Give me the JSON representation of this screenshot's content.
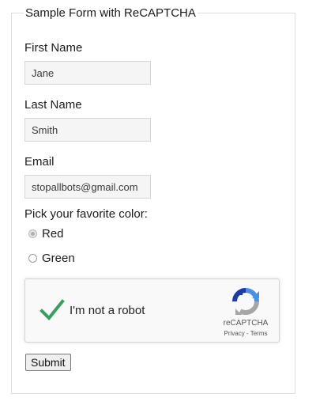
{
  "form": {
    "legend": "Sample Form with ReCAPTCHA",
    "first_name_label": "First Name",
    "first_name_value": "Jane",
    "last_name_label": "Last Name",
    "last_name_value": "Smith",
    "email_label": "Email",
    "email_value": "stopallbots@gmail.com",
    "color_prompt": "Pick your favorite color:",
    "color_options": [
      {
        "label": "Red",
        "checked": true
      },
      {
        "label": "Green",
        "checked": false
      }
    ],
    "submit_label": "Submit"
  },
  "recaptcha": {
    "label": "I'm not a robot",
    "checked": true,
    "brand": "reCAPTCHA",
    "privacy_link": "Privacy",
    "separator": "-",
    "terms_link": "Terms",
    "check_color": "#3a9c5e",
    "logo_blue": "#4a90e2",
    "logo_dark": "#1c3aa9",
    "logo_gray": "#a6a6a6"
  }
}
